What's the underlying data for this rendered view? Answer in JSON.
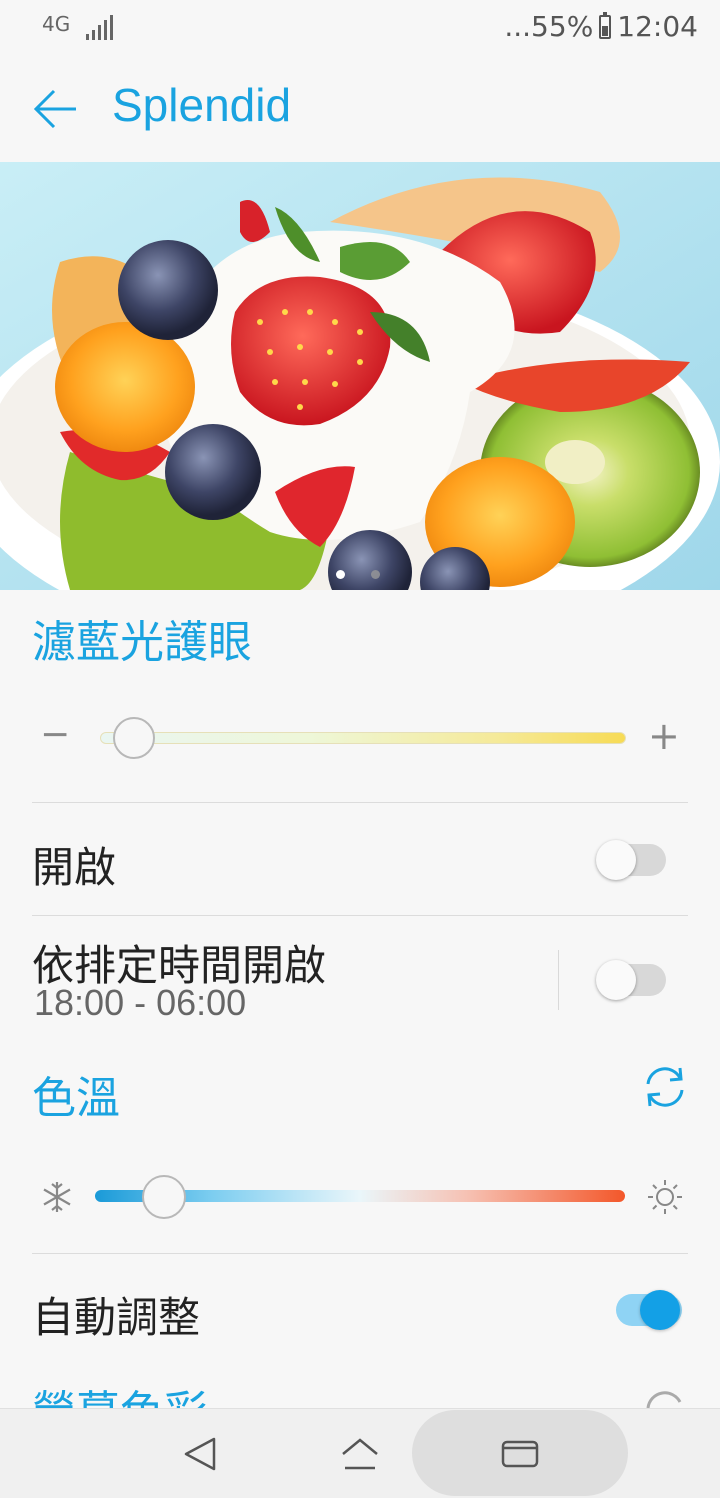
{
  "status_bar": {
    "network": "4G",
    "battery_text": "...55%",
    "time": "12:04"
  },
  "app_bar": {
    "title": "Splendid",
    "back_icon": "arrow-left-icon"
  },
  "carousel": {
    "pages": 2,
    "active_page": 1
  },
  "blue_light_filter": {
    "title": "濾藍光護眼",
    "minus_label": "−",
    "plus_label": "+",
    "level": 0.05,
    "enable_label": "開啟",
    "enable_on": false,
    "schedule_label": "依排定時間開啟",
    "schedule_time": "18:00 - 06:00",
    "schedule_on": false
  },
  "color_temperature": {
    "title": "色溫",
    "reset_icon": "refresh-icon",
    "cold_icon": "snowflake-icon",
    "warm_icon": "sun-icon",
    "level": 0.13,
    "auto_label": "自動調整",
    "auto_on": true
  },
  "next_section": {
    "title": "螢幕色彩"
  },
  "nav_bar": {
    "back_icon": "triangle-back-icon",
    "home_icon": "home-icon",
    "recents_icon": "recents-icon"
  },
  "colors": {
    "accent": "#1aa3e0",
    "switch_on": "#13a0e6"
  }
}
